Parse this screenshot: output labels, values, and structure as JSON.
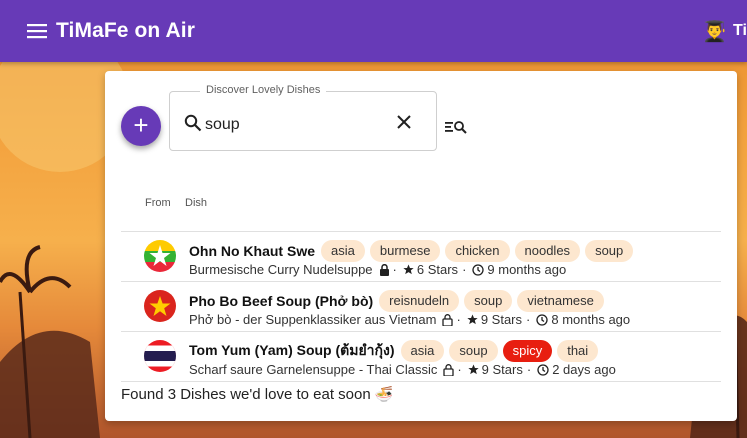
{
  "app": {
    "title": "TiMaFe on Air"
  },
  "user": {
    "avatar_emoji": "👨‍🎓",
    "name": "Till"
  },
  "search": {
    "label": "Discover Lovely Dishes",
    "value": "soup"
  },
  "table": {
    "col_from": "From",
    "col_dish": "Dish"
  },
  "dishes": [
    {
      "name": "Ohn No Khaut Swe",
      "tags": [
        "asia",
        "burmese",
        "chicken",
        "noodles",
        "soup"
      ],
      "subtitle": "Burmesische Curry Nudelsuppe",
      "stars": "6 Stars",
      "age": "9 months ago",
      "flag": "myanmar-flag"
    },
    {
      "name": "Pho Bo Beef Soup (Phở bò)",
      "tags": [
        "reisnudeln",
        "soup",
        "vietnamese"
      ],
      "subtitle": "Phở bò - der Suppenklassiker aus Vietnam",
      "stars": "9 Stars",
      "age": "8 months ago",
      "flag": "vietnam-flag"
    },
    {
      "name": "Tom Yum (Yam) Soup (ต้มยำกุ้ง)",
      "tags": [
        "asia",
        "soup",
        "spicy",
        "thai"
      ],
      "subtitle": "Scharf saure Garnelensuppe - Thai Classic",
      "stars": "9 Stars",
      "age": "2 days ago",
      "flag": "thailand-flag"
    }
  ],
  "footer": {
    "summary": "Found 3 Dishes we'd love to eat soon 🍜"
  },
  "colors": {
    "primary": "#673ab7",
    "tag_bg": "#fde7cf",
    "spicy_tag": "#e81e10"
  },
  "icons": [
    "menu-icon",
    "search-icon",
    "close-icon",
    "filter-search-icon",
    "lock-icon",
    "star-icon",
    "clock-icon",
    "plus-icon"
  ]
}
